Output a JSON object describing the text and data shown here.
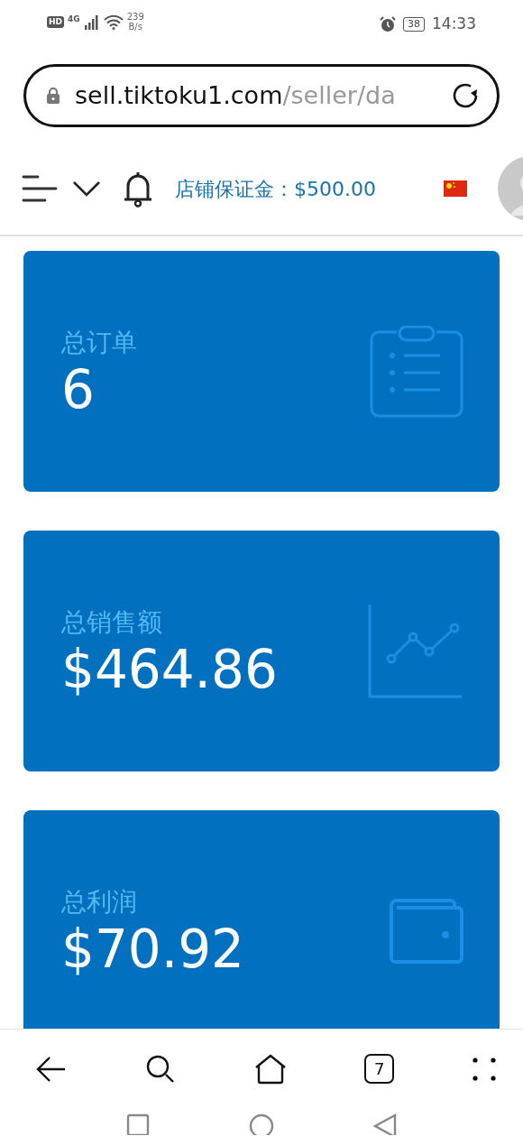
{
  "status_bar": {
    "hd": "HD",
    "network": "4G",
    "speed": "239",
    "speed_unit": "B/s",
    "battery": "38",
    "time": "14:33"
  },
  "address_bar": {
    "domain": "sell.tiktoku1.com",
    "path": "/seller/da"
  },
  "header": {
    "deposit_label": "店铺保证金：",
    "deposit_value": "$500.00"
  },
  "cards": [
    {
      "kind": "orders",
      "title": "总订单",
      "value": "6"
    },
    {
      "kind": "sales",
      "title": "总销售额",
      "value": "$464.86"
    },
    {
      "kind": "profit",
      "title": "总利润",
      "value": "$70.92"
    }
  ],
  "browser_toolbar": {
    "tab_count": "7"
  }
}
